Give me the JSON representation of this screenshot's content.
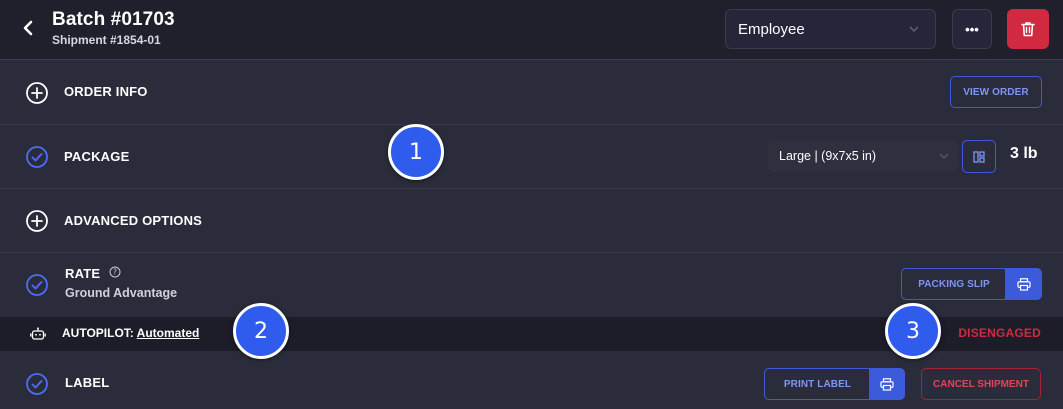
{
  "header": {
    "title": "Batch #01703",
    "subtitle": "Shipment #1854-01",
    "user_select": "Employee",
    "more_label": "•••"
  },
  "sections": {
    "order_info": {
      "label": "ORDER INFO",
      "button": "VIEW ORDER"
    },
    "package": {
      "label": "PACKAGE",
      "select_value": "Large | (9x7x5 in)",
      "weight": "3 lb"
    },
    "advanced": {
      "label": "ADVANCED OPTIONS"
    },
    "rate": {
      "label": "RATE",
      "service": "Ground Advantage",
      "button": "PACKING SLIP"
    },
    "autopilot": {
      "label": "AUTOPILOT:",
      "value": "Automated",
      "status": "DISENGAGED"
    },
    "label": {
      "label": "LABEL",
      "print_button": "PRINT LABEL",
      "cancel_button": "CANCEL SHIPMENT"
    }
  },
  "markers": {
    "m1": "1",
    "m2": "2",
    "m3": "3"
  },
  "colors": {
    "background": "#2b2c3b",
    "header": "#1f202c",
    "accent": "#3b5bdb",
    "danger": "#d1293f",
    "marker": "#2f5cec"
  },
  "icons": [
    "back-chevron-icon",
    "chevron-down-icon",
    "trash-icon",
    "plus-circle-icon",
    "check-circle-icon",
    "help-circle-icon",
    "robot-icon",
    "printer-icon",
    "package-layout-icon"
  ]
}
